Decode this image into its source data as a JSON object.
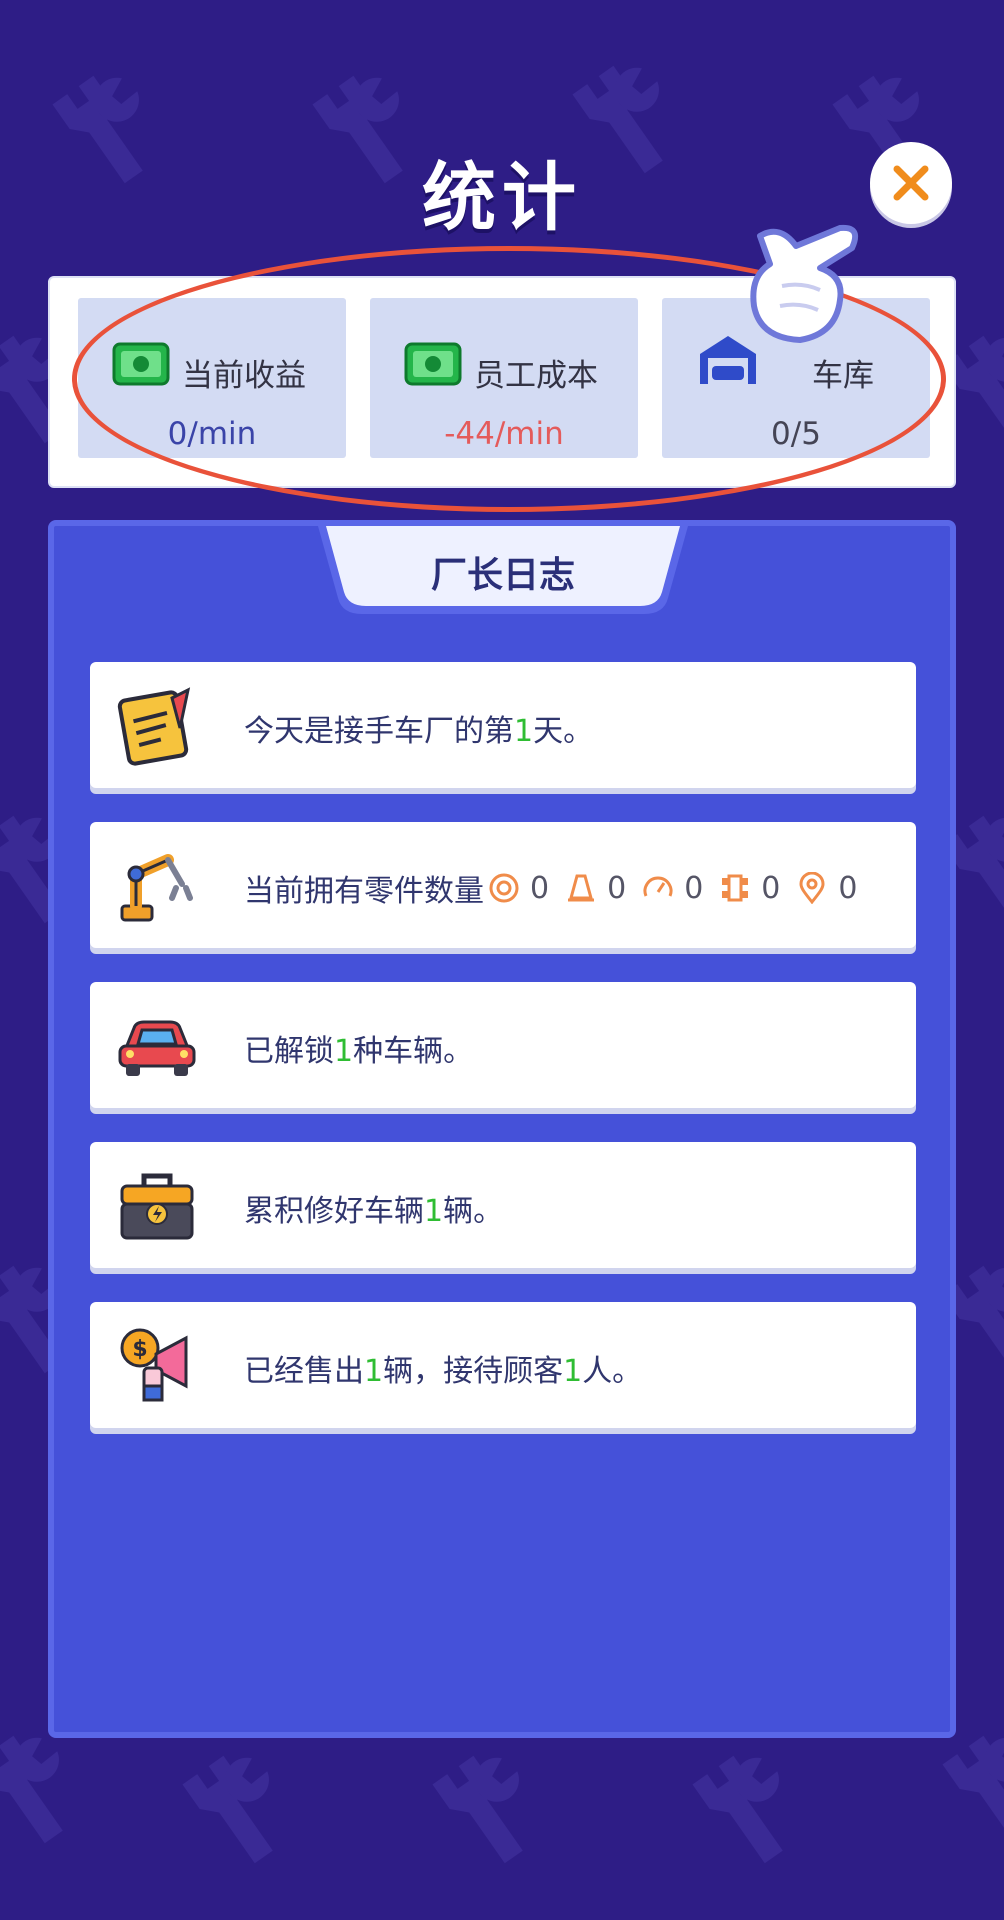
{
  "title": "统计",
  "stats": [
    {
      "label": "当前收益",
      "value": "0/min",
      "value_color": "#3a44a8",
      "icon": "cash-icon"
    },
    {
      "label": "员工成本",
      "value": "-44/min",
      "value_color": "#e45b5b",
      "icon": "cash-icon"
    },
    {
      "label": "车库",
      "value": "0/5",
      "value_color": "#444455",
      "icon": "garage-icon"
    }
  ],
  "log": {
    "tab_label": "厂长日志",
    "entries": [
      {
        "icon": "notepad-icon",
        "parts": [
          "今天是接手车厂的第",
          "1",
          "天。"
        ]
      },
      {
        "icon": "robot-arm-icon",
        "label": "当前拥有零件数量",
        "part_counts": [
          {
            "icon": "tire-icon",
            "count": "0"
          },
          {
            "icon": "cone-icon",
            "count": "0"
          },
          {
            "icon": "speedometer-icon",
            "count": "0"
          },
          {
            "icon": "chassis-icon",
            "count": "0"
          },
          {
            "icon": "location-pin-icon",
            "count": "0"
          }
        ]
      },
      {
        "icon": "red-car-icon",
        "parts": [
          "已解锁",
          "1",
          "种车辆。"
        ]
      },
      {
        "icon": "toolbox-icon",
        "parts": [
          "累积修好车辆",
          "1",
          "辆。"
        ]
      },
      {
        "icon": "megaphone-icon",
        "parts": [
          "已经售出",
          "1",
          "辆，接待顾客",
          "1",
          "人。"
        ]
      }
    ]
  },
  "colors": {
    "background": "#2e1d86",
    "panel": "#4551d9",
    "highlight": "#2fbd33",
    "annotation": "#e9523a"
  }
}
